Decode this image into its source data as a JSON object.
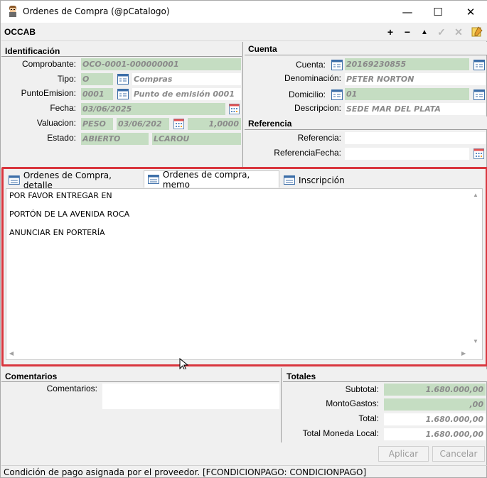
{
  "window": {
    "title": "Ordenes de Compra (@pCatalogo)",
    "minimize": "—",
    "maximize": "☐",
    "close": "✕"
  },
  "toolbar": {
    "form_id": "OCCAB",
    "add": "+",
    "remove": "−",
    "up": "▲",
    "confirm": "✓",
    "cancel": "✕"
  },
  "identificacion": {
    "header": "Identificación",
    "comprobante_label": "Comprobante:",
    "comprobante_value": "OCO-0001-000000001",
    "tipo_label": "Tipo:",
    "tipo_code": "O",
    "tipo_desc": "Compras",
    "punto_label": "PuntoEmision:",
    "punto_code": "0001",
    "punto_desc": "Punto de emisión 0001",
    "fecha_label": "Fecha:",
    "fecha_value": "03/06/2025",
    "valuacion_label": "Valuacion:",
    "valuacion_moneda": "PESO",
    "valuacion_fecha": "03/06/202",
    "valuacion_cotiz": "1,0000",
    "estado_label": "Estado:",
    "estado_value": "ABIERTO",
    "estado_usuario": "LCAROU"
  },
  "cuenta": {
    "header": "Cuenta",
    "cuenta_label": "Cuenta:",
    "cuenta_value": "20169230855",
    "denominacion_label": "Denominación:",
    "denominacion_value": "PETER NORTON",
    "domicilio_label": "Domicilio:",
    "domicilio_value": "01",
    "descripcion_label": "Descripcion:",
    "descripcion_value": "SEDE MAR DEL PLATA"
  },
  "referencia": {
    "header": "Referencia",
    "referencia_label": "Referencia:",
    "referencia_value": "",
    "fecha_label": "ReferenciaFecha:",
    "fecha_value": ""
  },
  "tabs": {
    "detalle": "Ordenes de Compra, detalle",
    "memo": "Ordenes de compra, memo",
    "inscripcion": "Inscripción"
  },
  "memo": {
    "line1": "POR FAVOR ENTREGAR EN",
    "line2": "PORTÓN DE LA AVENIDA ROCA",
    "line3": "ANUNCIAR EN PORTERÍA"
  },
  "comentarios": {
    "header": "Comentarios",
    "label": "Comentarios:",
    "value": ""
  },
  "totales": {
    "header": "Totales",
    "subtotal_label": "Subtotal:",
    "subtotal_value": "1.680.000,00",
    "gastos_label": "MontoGastos:",
    "gastos_value": ",00",
    "total_label": "Total:",
    "total_value": "1.680.000,00",
    "total_local_label": "Total Moneda Local:",
    "total_local_value": "1.680.000,00"
  },
  "buttons": {
    "aplicar": "Aplicar",
    "cancelar": "Cancelar"
  },
  "status": "Condición de pago asignada por el proveedor. [FCONDICIONPAGO: CONDICIONPAGO]"
}
